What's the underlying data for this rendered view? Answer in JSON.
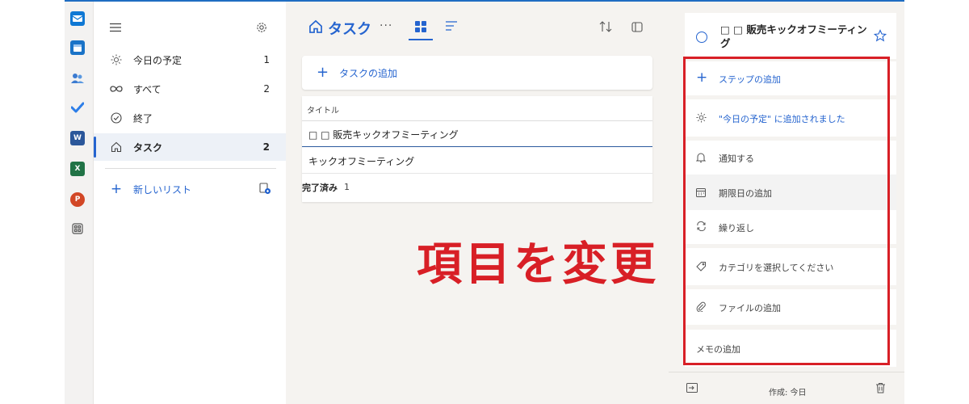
{
  "colors": {
    "accent": "#2564cf",
    "annotation": "#d81f26",
    "outlook": "#0f78d4",
    "calendar": "#1a73c7",
    "people": "#3b7bd0",
    "todo": "#2d7ee8",
    "word": "#2b579a",
    "excel": "#217346",
    "powerpoint": "#d24726"
  },
  "rail": {
    "icons": [
      "outlook-icon",
      "calendar-icon",
      "people-icon",
      "todo-icon",
      "word-icon",
      "excel-icon",
      "powerpoint-icon",
      "apps-icon"
    ],
    "word_letter": "W",
    "excel_letter": "X",
    "powerpoint_letter": "P"
  },
  "nav": {
    "items": [
      {
        "label": "今日の予定",
        "count": "1",
        "icon": "sun-icon"
      },
      {
        "label": "すべて",
        "count": "2",
        "icon": "infinity-icon"
      },
      {
        "label": "終了",
        "count": "",
        "icon": "check-circle-icon"
      },
      {
        "label": "タスク",
        "count": "2",
        "icon": "home-icon"
      }
    ],
    "new_list": "新しいリスト"
  },
  "main": {
    "title": "タスク",
    "more": "···",
    "add_task": "タスクの追加",
    "column_title": "タイトル",
    "tasks": [
      "□ □ 販売キックオフミーティング",
      "キックオフミーティング"
    ],
    "completed_label": "完了済み",
    "completed_count": "1"
  },
  "overlay_text": "項目を変更",
  "detail": {
    "task_title": "□ □ 販売キックオフミーティング",
    "rows": [
      {
        "label": "ステップの追加",
        "icon": "plus-icon"
      },
      {
        "label": "\"今日の予定\" に追加されました",
        "icon": "sun-icon"
      },
      {
        "label": "通知する",
        "icon": "bell-icon"
      },
      {
        "label": "期限日の追加",
        "icon": "calendar-icon"
      },
      {
        "label": "繰り返し",
        "icon": "repeat-icon"
      },
      {
        "label": "カテゴリを選択してください",
        "icon": "tag-icon"
      },
      {
        "label": "ファイルの追加",
        "icon": "paperclip-icon"
      },
      {
        "label": "メモの追加",
        "icon": ""
      }
    ],
    "created": "作成: 今日"
  }
}
